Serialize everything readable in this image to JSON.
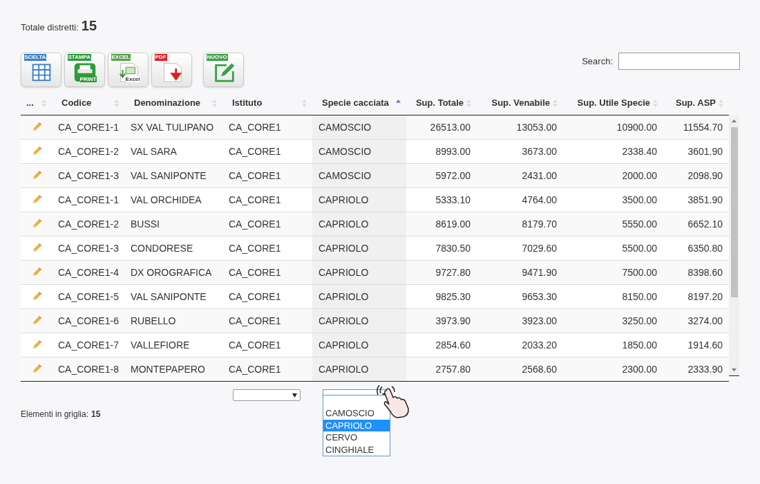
{
  "summary": {
    "label": "Totale distretti:",
    "value": "15"
  },
  "toolbar": [
    {
      "kind": "grid",
      "tag": "SCELTA"
    },
    {
      "kind": "print",
      "tag": "STAMPA",
      "sub": "PRINT"
    },
    {
      "kind": "excel",
      "tag": "EXCEL",
      "sub": "Excel"
    },
    {
      "kind": "pdf",
      "tag": "PDF"
    },
    {
      "kind": "new",
      "tag": "NUOVO"
    }
  ],
  "search": {
    "label": "Search:"
  },
  "table": {
    "columns": [
      {
        "label": "...",
        "sorted": false,
        "numeric": false
      },
      {
        "label": "Codice",
        "sorted": false,
        "numeric": false
      },
      {
        "label": "Denominazione",
        "sorted": false,
        "numeric": false
      },
      {
        "label": "Istituto",
        "sorted": false,
        "numeric": false
      },
      {
        "label": "Specie cacciata",
        "sorted": true,
        "numeric": false
      },
      {
        "label": "Sup. Totale",
        "sorted": false,
        "numeric": true
      },
      {
        "label": "Sup. Venabile",
        "sorted": false,
        "numeric": true
      },
      {
        "label": "Sup. Utile Specie",
        "sorted": false,
        "numeric": true
      },
      {
        "label": "Sup. ASP",
        "sorted": false,
        "numeric": true
      }
    ],
    "rows": [
      [
        "",
        "CA_CORE1-1",
        "SX VAL TULIPANO",
        "CA_CORE1",
        "CAMOSCIO",
        "26513.00",
        "13053.00",
        "10900.00",
        "11554.70"
      ],
      [
        "",
        "CA_CORE1-2",
        "VAL SARA",
        "CA_CORE1",
        "CAMOSCIO",
        "8993.00",
        "3673.00",
        "2338.40",
        "3601.90"
      ],
      [
        "",
        "CA_CORE1-3",
        "VAL SANIPONTE",
        "CA_CORE1",
        "CAMOSCIO",
        "5972.00",
        "2431.00",
        "2000.00",
        "2098.90"
      ],
      [
        "",
        "CA_CORE1-1",
        "VAL ORCHIDEA",
        "CA_CORE1",
        "CAPRIOLO",
        "5333.10",
        "4764.00",
        "3500.00",
        "3851.90"
      ],
      [
        "",
        "CA_CORE1-2",
        "BUSSI",
        "CA_CORE1",
        "CAPRIOLO",
        "8619.00",
        "8179.70",
        "5550.00",
        "6652.10"
      ],
      [
        "",
        "CA_CORE1-3",
        "CONDORESE",
        "CA_CORE1",
        "CAPRIOLO",
        "7830.50",
        "7029.60",
        "5500.00",
        "6350.80"
      ],
      [
        "",
        "CA_CORE1-4",
        "DX OROGRAFICA",
        "CA_CORE1",
        "CAPRIOLO",
        "9727.80",
        "9471.90",
        "7500.00",
        "8398.60"
      ],
      [
        "",
        "CA_CORE1-5",
        "VAL SANIPONTE",
        "CA_CORE1",
        "CAPRIOLO",
        "9825.30",
        "9653.30",
        "8150.00",
        "8197.20"
      ],
      [
        "",
        "CA_CORE1-6",
        "RUBELLO",
        "CA_CORE1",
        "CAPRIOLO",
        "3973.90",
        "3923.00",
        "3250.00",
        "3274.00"
      ],
      [
        "",
        "CA_CORE1-7",
        "VALLEFIORE",
        "CA_CORE1",
        "CAPRIOLO",
        "2854.60",
        "2033.20",
        "1850.00",
        "1914.60"
      ],
      [
        "",
        "CA_CORE1-8",
        "MONTEPAPERO",
        "CA_CORE1",
        "CAPRIOLO",
        "2757.80",
        "2568.60",
        "2300.00",
        "2333.90"
      ]
    ]
  },
  "filter_options": [
    {
      "label": "CAMOSCIO",
      "selected": false
    },
    {
      "label": "CAPRIOLO",
      "selected": true
    },
    {
      "label": "CERVO",
      "selected": false
    },
    {
      "label": "CINGHIALE",
      "selected": false
    }
  ],
  "footer": {
    "label": "Elementi in griglia:",
    "value": "15"
  }
}
